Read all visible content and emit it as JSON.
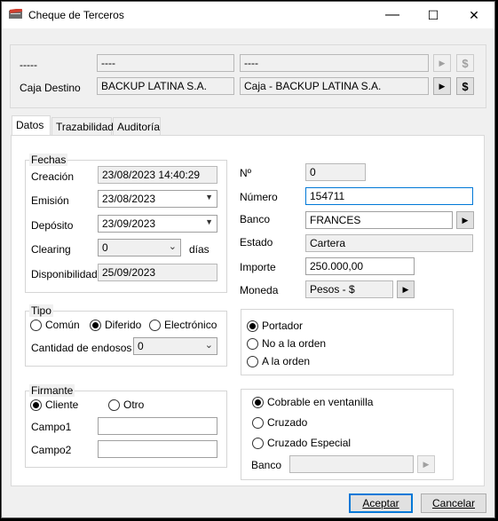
{
  "window": {
    "title": "Cheque de Terceros",
    "minimize": "—",
    "maximize": "☐",
    "close": "✕"
  },
  "header": {
    "row1_label": "-----",
    "row1_field1": "----",
    "row1_field2": "----",
    "caja_destino_label": "Caja Destino",
    "caja_destino_value": "BACKUP LATINA S.A.",
    "caja_destino_account": "Caja - BACKUP LATINA S.A.",
    "dollar": "$"
  },
  "tabs": [
    {
      "label": "Datos"
    },
    {
      "label": "Trazabilidad"
    },
    {
      "label": "Auditoría"
    }
  ],
  "fechas": {
    "legend": "Fechas",
    "creacion_label": "Creación",
    "creacion_value": "23/08/2023 14:40:29",
    "emision_label": "Emisión",
    "emision_value": "23/08/2023",
    "deposito_label": "Depósito",
    "deposito_value": "23/09/2023",
    "clearing_label": "Clearing",
    "clearing_value": "0",
    "dias_label": "días",
    "disponibilidad_label": "Disponibilidad",
    "disponibilidad_value": "25/09/2023"
  },
  "right": {
    "nro_label": "Nº",
    "nro_value": "0",
    "numero_label": "Número",
    "numero_value": "154711",
    "banco_label": "Banco",
    "banco_value": "FRANCES",
    "estado_label": "Estado",
    "estado_value": "Cartera",
    "importe_label": "Importe",
    "importe_value": "250.000,00",
    "moneda_label": "Moneda",
    "moneda_value": "Pesos - $"
  },
  "tipo": {
    "legend": "Tipo",
    "options": [
      "Común",
      "Diferido",
      "Electrónico"
    ],
    "selected": "Diferido",
    "endosos_label": "Cantidad de endosos",
    "endosos_value": "0"
  },
  "orden": {
    "options": [
      "Portador",
      "No a la orden",
      "A la orden"
    ],
    "selected": "Portador"
  },
  "firmante": {
    "legend": "Firmante",
    "options": [
      "Cliente",
      "Otro"
    ],
    "selected": "Cliente",
    "campo1_label": "Campo1",
    "campo1_value": "",
    "campo2_label": "Campo2",
    "campo2_value": ""
  },
  "cobro": {
    "options": [
      "Cobrable en ventanilla",
      "Cruzado",
      "Cruzado Especial"
    ],
    "selected": "Cobrable en ventanilla",
    "banco_label": "Banco",
    "banco_value": ""
  },
  "footer": {
    "aceptar": "Aceptar",
    "cancelar": "Cancelar"
  }
}
